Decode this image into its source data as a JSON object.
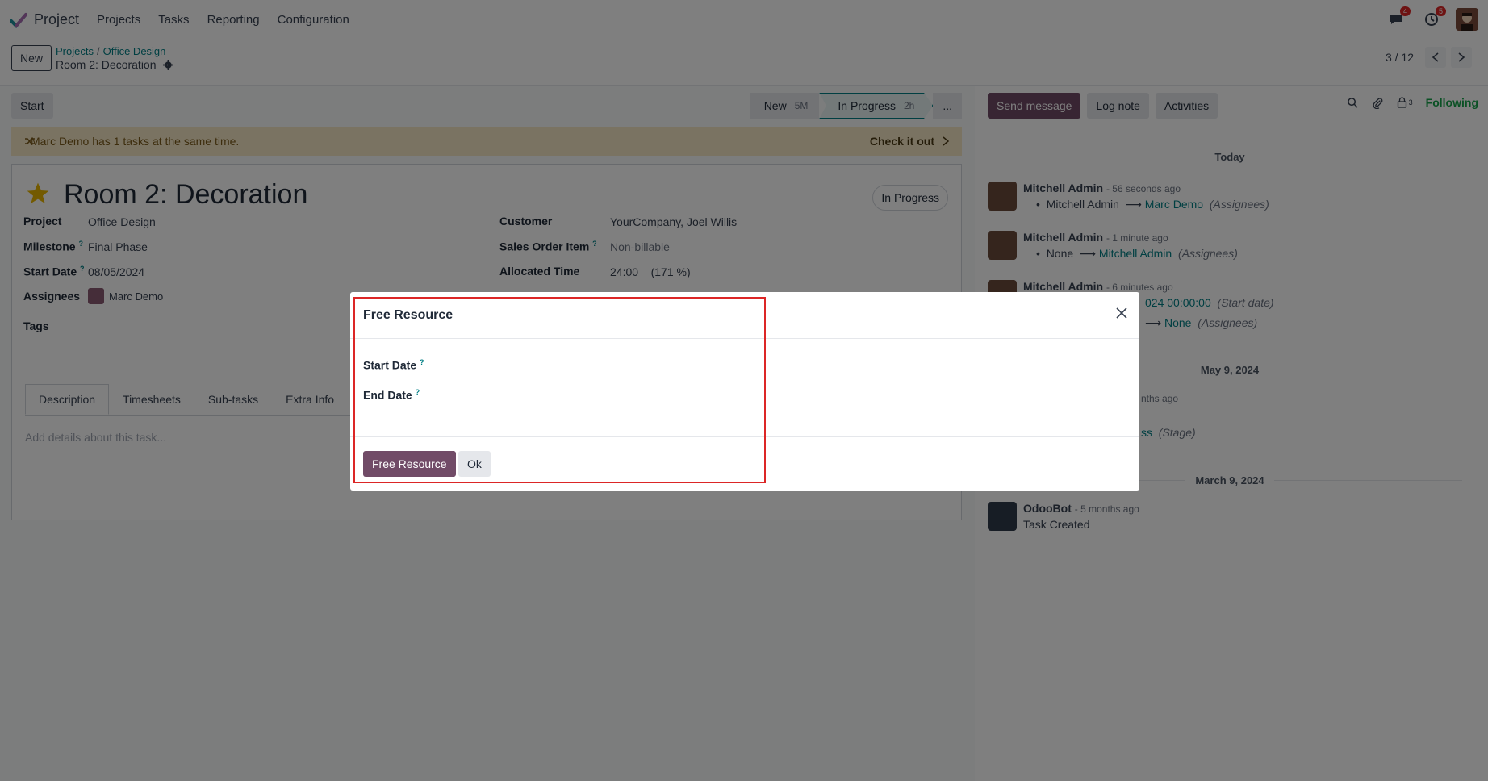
{
  "nav": {
    "app_name": "Project",
    "menu": [
      "Projects",
      "Tasks",
      "Reporting",
      "Configuration"
    ],
    "messages_count": "4",
    "activities_count": "5",
    "icons": [
      "chat-icon",
      "clock-icon",
      "user-avatar"
    ]
  },
  "control": {
    "new_label": "New",
    "breadcrumb": [
      "Projects",
      "Office Design"
    ],
    "current": "Room 2: Decoration",
    "pager": "3 / 12"
  },
  "statusbar": {
    "start_label": "Start",
    "stages": [
      {
        "label": "New",
        "duration": "5M"
      },
      {
        "label": "In Progress",
        "duration": "2h"
      }
    ],
    "more_label": "..."
  },
  "alert": {
    "message": "Marc Demo has 1 tasks at the same time.",
    "action": "Check it out"
  },
  "task": {
    "title": "Room 2: Decoration",
    "stage_chip": "In Progress",
    "fields_left": [
      {
        "label": "Project",
        "value": "Office Design",
        "help": false
      },
      {
        "label": "Milestone",
        "value": "Final Phase",
        "help": true
      },
      {
        "label": "Start Date",
        "value": "08/05/2024",
        "help": true
      },
      {
        "label": "Assignees",
        "value": "Marc Demo",
        "help": false
      },
      {
        "label": "Tags",
        "value": "",
        "help": false
      }
    ],
    "fields_right": [
      {
        "label": "Customer",
        "value": "YourCompany, Joel Willis",
        "help": false
      },
      {
        "label": "Sales Order Item",
        "value": "Non-billable",
        "help": true
      },
      {
        "label": "Allocated Time",
        "value": "24:00",
        "extra": "(171 %)",
        "help": false
      }
    ],
    "tabs": [
      "Description",
      "Timesheets",
      "Sub-tasks",
      "Extra Info"
    ],
    "description_placeholder": "Add details about this task..."
  },
  "chatter": {
    "buttons": [
      "Send message",
      "Log note",
      "Activities"
    ],
    "followers_count": "3",
    "following_label": "Following",
    "days": [
      "Today",
      "May 9, 2024",
      "March 9, 2024"
    ],
    "messages": [
      {
        "author": "Mitchell Admin",
        "when": "- 56 seconds ago",
        "old": "Mitchell Admin",
        "new": "Marc Demo",
        "field": "(Assignees)"
      },
      {
        "author": "Mitchell Admin",
        "when": "- 1 minute ago",
        "old": "None",
        "new": "Mitchell Admin",
        "field": "(Assignees)"
      },
      {
        "author": "Mitchell Admin",
        "when": "- 6 minutes ago",
        "partial1": "024 00:00:00",
        "field1": "(Start date)",
        "partial2": "None",
        "field2": "(Assignees)"
      },
      {
        "partial_when": "nths ago",
        "partial_new": "ss",
        "field": "(Stage)"
      },
      {
        "author": "OdooBot",
        "when": "- 5 months ago",
        "text": "Task Created"
      }
    ]
  },
  "dialog": {
    "title": "Free Resource",
    "start_label": "Start Date",
    "end_label": "End Date",
    "help_mark": "?",
    "start_value": "",
    "primary_label": "Free Resource",
    "secondary_label": "Ok"
  },
  "colors": {
    "brand": "#714b67",
    "link": "#017e84",
    "alert_bg": "#f5e6c4",
    "highlight": "#dc2626"
  }
}
